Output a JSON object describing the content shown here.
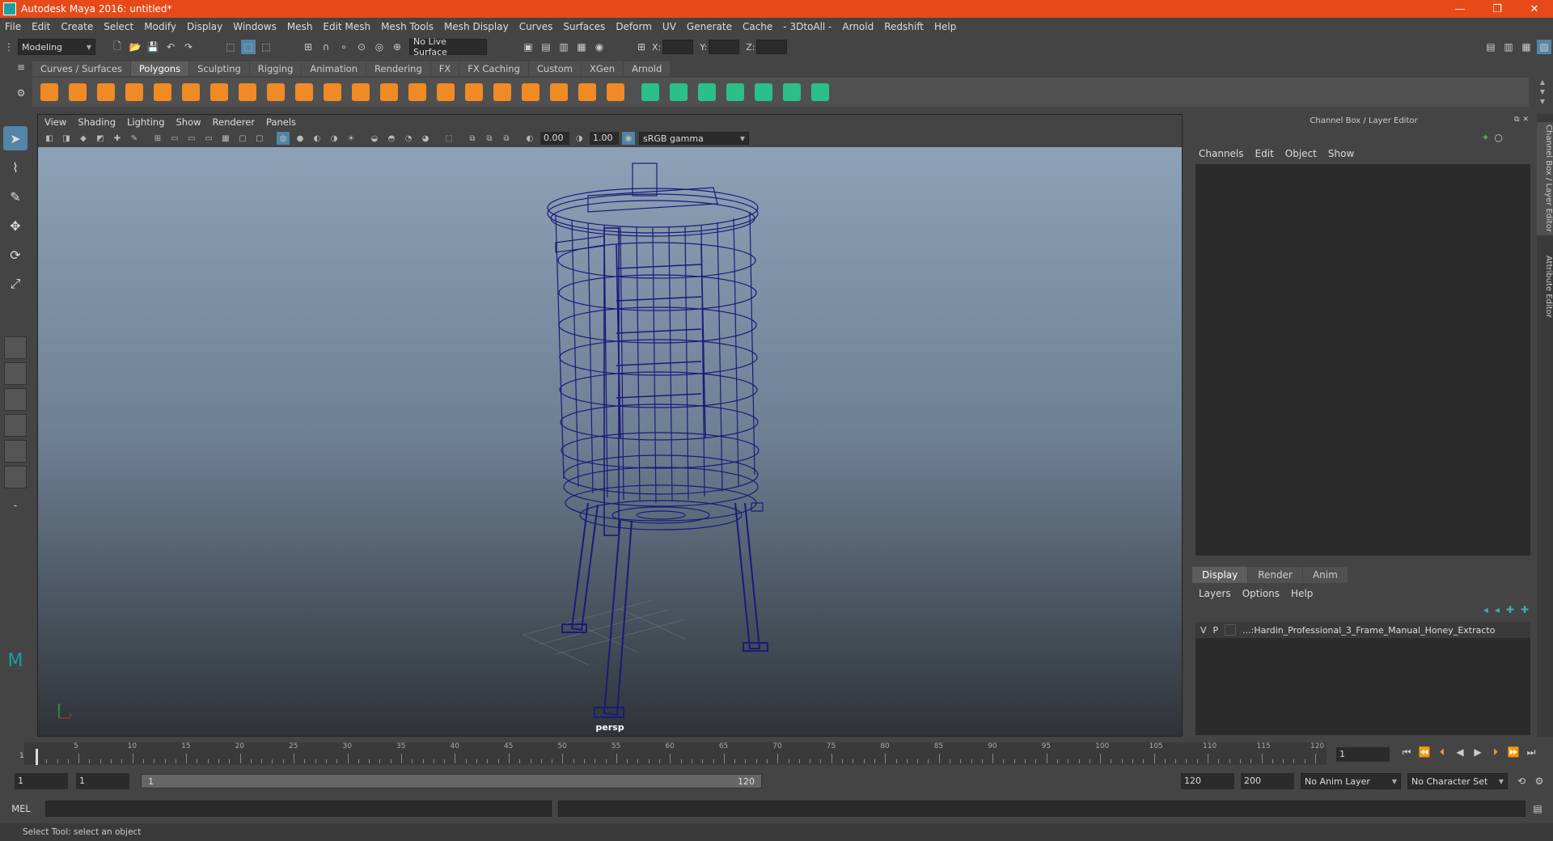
{
  "window": {
    "title": "Autodesk Maya 2016: untitled*",
    "controls": [
      "—",
      "❐",
      "✕"
    ]
  },
  "menubar": [
    "File",
    "Edit",
    "Create",
    "Select",
    "Modify",
    "Display",
    "Windows",
    "Mesh",
    "Edit Mesh",
    "Mesh Tools",
    "Mesh Display",
    "Curves",
    "Surfaces",
    "Deform",
    "UV",
    "Generate",
    "Cache",
    "- 3DtoAll -",
    "Arnold",
    "Redshift",
    "Help"
  ],
  "statusline": {
    "mode": "Modeling",
    "live_surface": "No Live Surface",
    "x_label": "X:",
    "y_label": "Y:",
    "z_label": "Z:"
  },
  "shelf": {
    "tabs": [
      "Curves / Surfaces",
      "Polygons",
      "Sculpting",
      "Rigging",
      "Animation",
      "Rendering",
      "FX",
      "FX Caching",
      "Custom",
      "XGen",
      "Arnold"
    ],
    "active_tab": "Polygons",
    "orange_icons": [
      "sphere-icon",
      "cube-icon",
      "cylinder-icon",
      "cone-icon",
      "torus-icon",
      "plane-icon",
      "pyramid-icon",
      "pipe-icon",
      "helix-icon",
      "soccer-ball-icon",
      "platonic-icon",
      "combine-icon",
      "separate-icon",
      "extract-icon",
      "smooth-icon",
      "boolean-icon",
      "mirror-icon",
      "extrude-icon",
      "bridge-icon",
      "bevel-icon",
      "merge-icon"
    ],
    "green_icons": [
      "uv-icon",
      "uv-planar-icon",
      "uv-cylindrical-icon",
      "uv-spherical-icon",
      "uv-auto-icon",
      "uv-editor-icon",
      "uv-layout-icon"
    ],
    "accent_orange": "#f08a24",
    "accent_green": "#2bbf8a"
  },
  "viewport": {
    "menu": [
      "View",
      "Shading",
      "Lighting",
      "Show",
      "Renderer",
      "Panels"
    ],
    "exposure": "0.00",
    "gamma": "1.00",
    "color_space": "sRGB gamma",
    "camera": "persp",
    "wire_color": "#1a1a7a"
  },
  "channel_box": {
    "title": "Channel Box / Layer Editor",
    "menu": [
      "Channels",
      "Edit",
      "Object",
      "Show"
    ],
    "tabs": [
      "Display",
      "Render",
      "Anim"
    ],
    "active_tab": "Display",
    "layer_menu": [
      "Layers",
      "Options",
      "Help"
    ],
    "layers": [
      {
        "v": "V",
        "p": "P",
        "name": "...:Hardin_Professional_3_Frame_Manual_Honey_Extracto"
      }
    ]
  },
  "side_tabs": [
    "Channel Box / Layer Editor",
    "Attribute Editor"
  ],
  "timeline": {
    "ticks": [
      "5",
      "10",
      "15",
      "20",
      "25",
      "30",
      "35",
      "40",
      "45",
      "50",
      "55",
      "60",
      "65",
      "70",
      "75",
      "80",
      "85",
      "90",
      "95",
      "100",
      "105",
      "110",
      "115",
      "120"
    ],
    "current_frame": "1",
    "start_label": "1"
  },
  "range": {
    "start": "1",
    "start2": "1",
    "slider_start": "1",
    "slider_end": "120",
    "end": "120",
    "end2": "200",
    "anim_layer": "No Anim Layer",
    "char_set": "No Character Set"
  },
  "cmdline": {
    "label": "MEL"
  },
  "helpline": "Select Tool: select an object"
}
